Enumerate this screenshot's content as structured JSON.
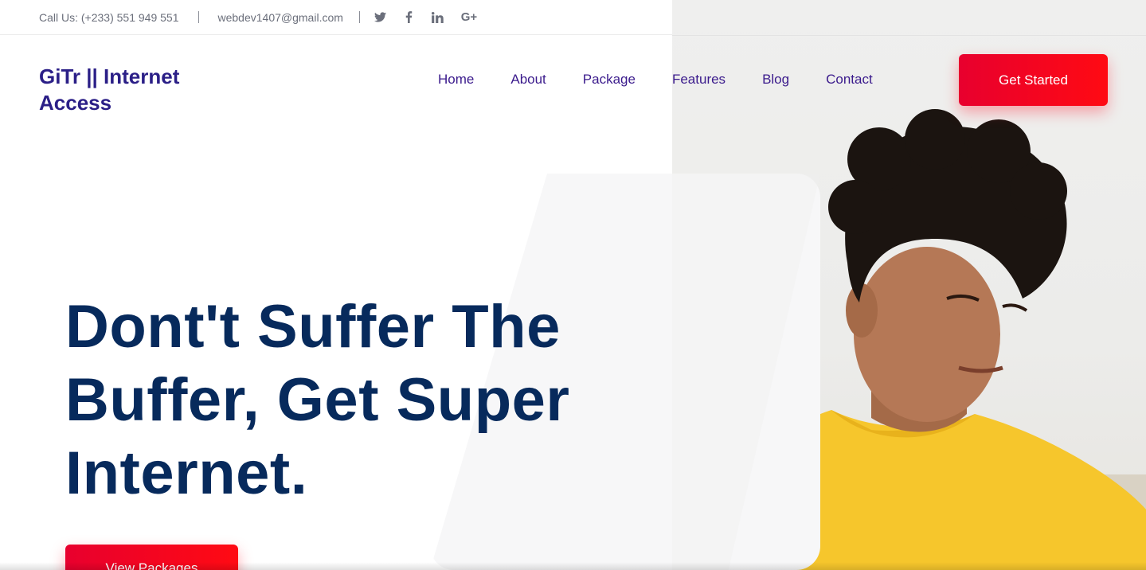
{
  "topbar": {
    "phone": "Call Us: (+233) 551 949 551",
    "email": "webdev1407@gmail.com",
    "social": [
      "twitter-icon",
      "facebook-icon",
      "linkedin-icon",
      "google-plus-icon"
    ]
  },
  "brand": {
    "name": "GiTr || Internet Access"
  },
  "nav": {
    "items": [
      {
        "label": "Home"
      },
      {
        "label": "About"
      },
      {
        "label": "Package"
      },
      {
        "label": "Features"
      },
      {
        "label": "Blog"
      },
      {
        "label": "Contact"
      }
    ],
    "cta_label": "Get Started"
  },
  "hero": {
    "title": "Dont't Suffer The Buffer, Get Super Internet.",
    "button_label": "View Packages",
    "image": "person-yellow-shirt-photo"
  },
  "colors": {
    "brand": "#2b1f87",
    "nav": "#3a1a8c",
    "accent": "#ff0a13",
    "heading": "#072a5c"
  }
}
